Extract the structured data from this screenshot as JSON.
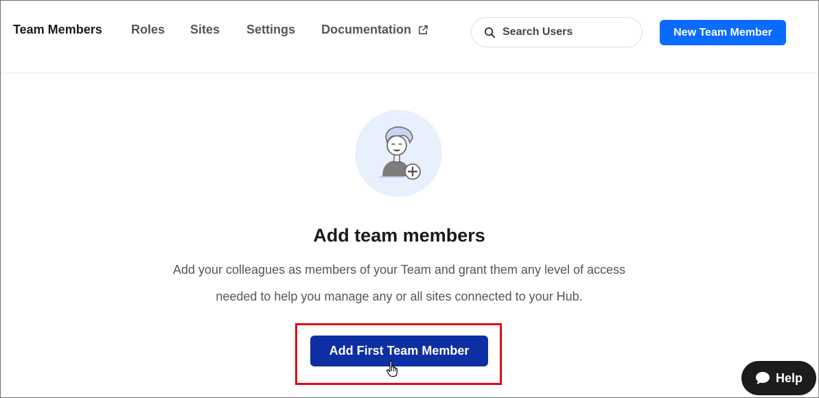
{
  "nav": {
    "items": [
      {
        "label": "Team Members",
        "active": true
      },
      {
        "label": "Roles"
      },
      {
        "label": "Sites"
      },
      {
        "label": "Settings"
      },
      {
        "label": "Documentation",
        "icon": "external-link-icon"
      }
    ]
  },
  "search": {
    "placeholder": "Search Users",
    "icon": "search-icon"
  },
  "header": {
    "new_member_label": "New Team Member"
  },
  "empty_state": {
    "illustration": "add-user-avatar-icon",
    "title": "Add team members",
    "description_line1": "Add your colleagues as members of your Team and grant them any level of access",
    "description_line2": "needed to help you manage any or all sites connected to your Hub.",
    "cta_label": "Add First Team Member"
  },
  "help": {
    "label": "Help",
    "icon": "chat-bubble-icon"
  },
  "colors": {
    "primary": "#0a6cff",
    "cta": "#0d2fa3",
    "highlight": "#e3000f",
    "help_bg": "#1c1c1c",
    "avatar_bg": "#e8effd"
  }
}
